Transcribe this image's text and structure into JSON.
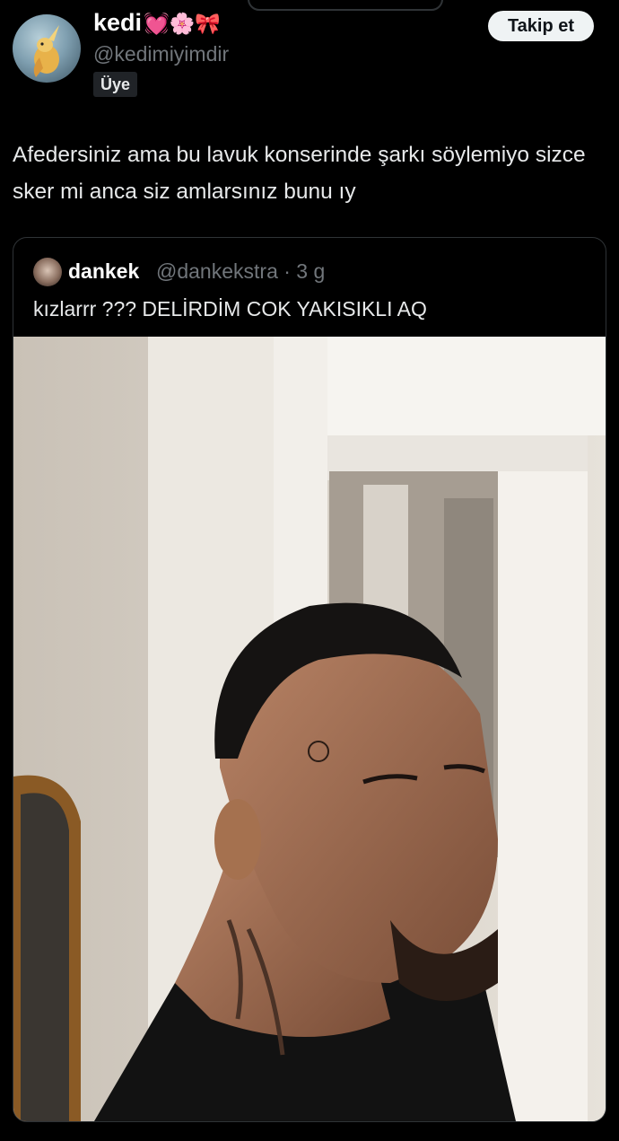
{
  "author": {
    "display_name": "kedi",
    "emojis": "💓🌸🎀",
    "handle": "@kedimiyimdir",
    "badge": "Üye"
  },
  "follow_button": {
    "label": "Takip et"
  },
  "tweet": {
    "text": "Afedersiniz ama bu lavuk konserinde şarkı söylemiyo sizce sker mi anca siz amlarsınız bunu ıy"
  },
  "quoted_tweet": {
    "name": "dankek",
    "handle": "@dankekstra",
    "time": "· 3 g",
    "text": "kızlarrr ??? DELİRDİM COK YAKISIKLI AQ"
  },
  "colors": {
    "background": "#000000",
    "text_primary": "#e7e9ea",
    "text_secondary": "#71767b",
    "follow_button_bg": "#eff3f4",
    "border": "#2f3336"
  }
}
